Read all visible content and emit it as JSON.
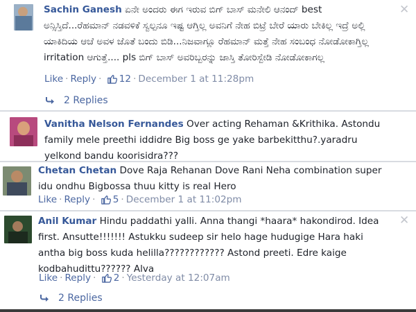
{
  "comments": [
    {
      "author": "Sachin Ganesh",
      "text": "ಏನೇ ಅಂದರು ಈಗ ಇರುವ ಬಿಗ್ ಬಾಸ್ ಮನೇಲಿ ಆನಂದ್ best ಅನ್ಸಿಸ್ತಿದೆ...ರೆಹಮಾನ್ ನಡವಳಿಕೆ ಸ್ವಲ್ಪನೂ ಇಷ್ಟ ಆಗ್ತಿಲ್ಲ ಅವನಿಗೆ ನೇಹ ಬಿಟ್ರೆ ಬೇರೆ ಯಾರು ಬೇಕಿಲ್ಲ ಇದ್ರೆ ಅಲ್ಲಿ ಯಾಕಿದಿಯ ಆಚೆ ಅವಳ ಜೊತೆ ಬಂದು ಬಿಡಿ...ನಿಜವಾಗ್ಲೂ ರೆಹಮಾನ್ ಮತ್ತೆ ನೇಹ ಸಂಬಂಧ ನೋಡೋಕಾಗ್ತಿಲ್ಲ irritation ಆಗುತ್ತೆ.... pls ಬಿಗ್ ಬಾಸ್ ಅವರಿಬ್ಬರನ್ನು ಜಾಸ್ತಿ ತೋರಿಸ್ಬೇಡಿ ನೋಡೋಕಾಗಲ್ಲ",
      "like_label": "Like",
      "reply_label": "Reply",
      "like_count": "12",
      "timestamp": "December 1 at 11:28pm",
      "replies_label": "2 Replies"
    },
    {
      "author": "Vanitha Nelson Fernandes",
      "text": "Over acting Rehaman &Krithika. Astondu family mele preethi iddidre Big boss ge yake barbekitthu?.yaradru yelkond bandu koorisidra???"
    },
    {
      "author": "Chetan Chetan",
      "text": "Dove Raja Rehanan Dove Rani Neha combination super idu ondhu Bigbossa thuu kitty is real Hero",
      "like_label": "Like",
      "reply_label": "Reply",
      "like_count": "5",
      "timestamp": "December 1 at 11:02pm"
    },
    {
      "author": "Anil Kumar",
      "text": "Hindu paddathi yalli. Anna thangi *haara* hakondirod. Idea first. Ansutte!!!!!!! Astukku sudeep sir helo hage hudugige Hara haki antha big boss kuda helilla???????????? Astond preeti. Edre kaige kodbahudittu?????? Alva",
      "like_label": "Like",
      "reply_label": "Reply",
      "like_count": "2",
      "timestamp": "Yesterday at 12:07am",
      "replies_label": "2 Replies"
    }
  ],
  "close_glyph": "✕",
  "icons": [
    "like-thumb-icon",
    "reply-arrow-icon",
    "close-icon"
  ],
  "colors": {
    "author": "#365899",
    "link": "#4b67a1",
    "meta": "#90949c"
  }
}
